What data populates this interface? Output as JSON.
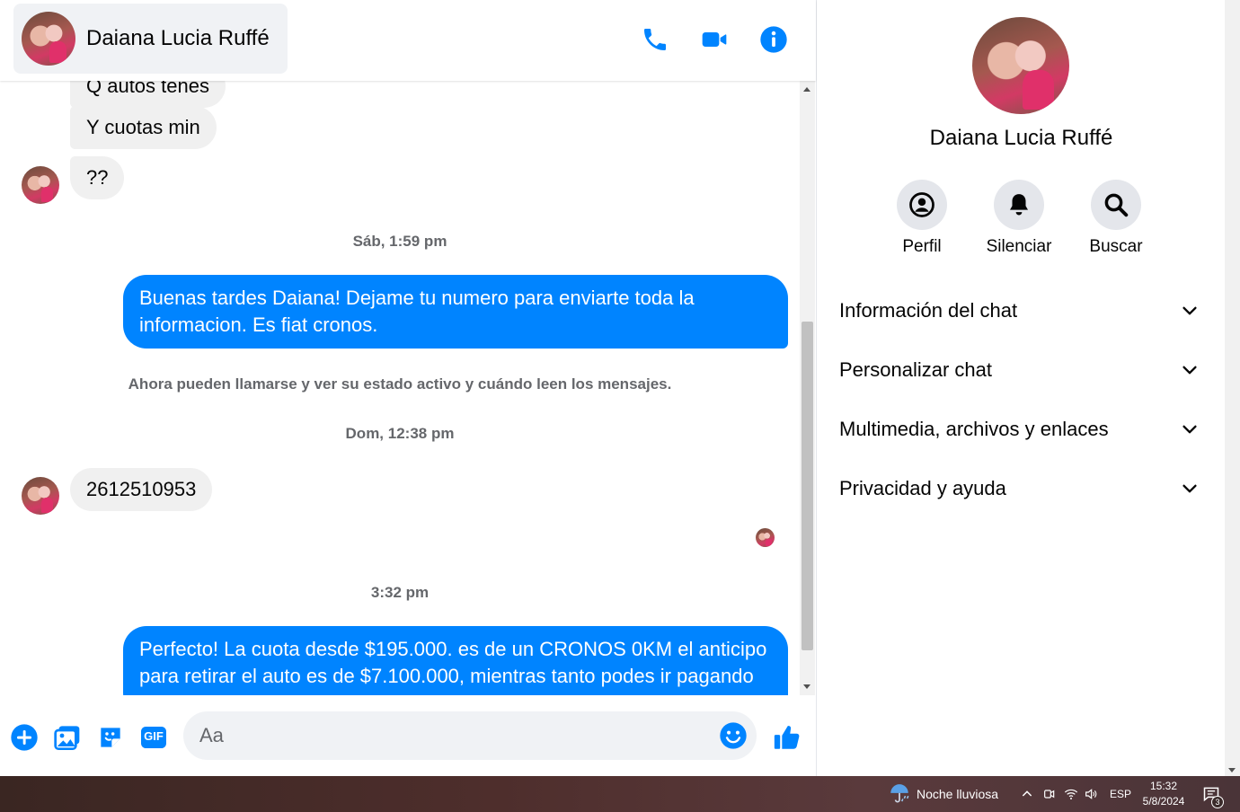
{
  "header": {
    "contact_name": "Daiana Lucia Ruffé",
    "icons": {
      "call": "phone-icon",
      "video": "video-camera-icon",
      "info": "info-icon"
    }
  },
  "conversation": {
    "messages": [
      {
        "id": "m1",
        "direction": "incoming",
        "text": "Q autos tenes"
      },
      {
        "id": "m2",
        "direction": "incoming",
        "text": "Y cuotas min"
      },
      {
        "id": "m3",
        "direction": "incoming",
        "text": "??"
      },
      {
        "id": "ts1",
        "type": "timestamp",
        "text": "Sáb, 1:59 pm"
      },
      {
        "id": "m4",
        "direction": "outgoing",
        "text": "Buenas tardes Daiana! Dejame tu numero para enviarte toda la informacion. Es fiat cronos."
      },
      {
        "id": "sys1",
        "type": "system",
        "text": "Ahora pueden llamarse y ver su estado activo y cuándo leen los mensajes."
      },
      {
        "id": "ts2",
        "type": "timestamp",
        "text": "Dom, 12:38 pm"
      },
      {
        "id": "m5",
        "direction": "incoming",
        "text": "2612510953"
      },
      {
        "id": "ts3",
        "type": "timestamp",
        "text": "3:32 pm"
      },
      {
        "id": "m6",
        "direction": "outgoing",
        "text": "Perfecto! La cuota desde $195.000. es de un CRONOS 0KM el anticipo para retirar el auto es de $7.100.000, mientras tanto podes ir pagando"
      }
    ]
  },
  "composer": {
    "placeholder": "Aa",
    "icons": [
      "plus-icon",
      "image-icon",
      "sticker-icon",
      "gif-icon",
      "emoji-icon",
      "thumbs-up-icon"
    ],
    "gif_label": "GIF"
  },
  "info_panel": {
    "name": "Daiana Lucia Ruffé",
    "actions": [
      {
        "label": "Perfil",
        "icon": "profile-icon"
      },
      {
        "label": "Silenciar",
        "icon": "bell-icon"
      },
      {
        "label": "Buscar",
        "icon": "search-icon"
      }
    ],
    "sections": [
      {
        "title": "Información del chat"
      },
      {
        "title": "Personalizar chat"
      },
      {
        "title": "Multimedia, archivos y enlaces"
      },
      {
        "title": "Privacidad y ayuda"
      }
    ]
  },
  "taskbar": {
    "weather": "Noche lluviosa",
    "language": "ESP",
    "time": "15:32",
    "date": "5/8/2024",
    "notification_count": "3"
  },
  "colors": {
    "accent": "#0084ff",
    "incoming_bubble": "#f0f0f0",
    "secondary_text": "#65676b"
  }
}
